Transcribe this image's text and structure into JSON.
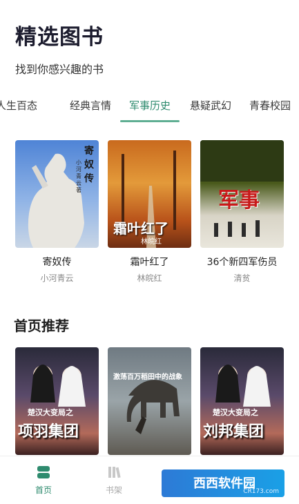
{
  "header": {
    "title": "精选图书",
    "subtitle": "找到你感兴趣的书"
  },
  "tabs": [
    {
      "label": "人生百态",
      "active": false
    },
    {
      "label": "经典言情",
      "active": false
    },
    {
      "label": "军事历史",
      "active": true
    },
    {
      "label": "悬疑武幻",
      "active": false
    },
    {
      "label": "青春校园",
      "active": false
    }
  ],
  "featured_books": [
    {
      "title": "寄奴传",
      "author": "小河青云",
      "cover_text": "寄奴传",
      "cover_sub": "小河青云 著"
    },
    {
      "title": "霜叶红了",
      "author": "林皖红",
      "cover_text": "霜叶红了",
      "cover_sub": "林皖红"
    },
    {
      "title": "36个新四军伤员",
      "author": "清贫",
      "cover_text": "军事"
    }
  ],
  "recommend": {
    "section_title": "首页推荐",
    "books": [
      {
        "cover_line1": "楚汉大变局之",
        "cover_line2": "项羽集团"
      },
      {
        "cover_line1": "激荡百万稻田中的战象"
      },
      {
        "cover_line1": "楚汉大变局之",
        "cover_line2": "刘邦集团"
      }
    ]
  },
  "bottom_nav": [
    {
      "label": "首页",
      "icon": "home-icon",
      "active": true
    },
    {
      "label": "书架",
      "icon": "bookshelf-icon",
      "active": false
    }
  ],
  "watermark": {
    "text": "西西软件园",
    "sub": "CR173.com"
  },
  "colors": {
    "accent": "#2e8b6e",
    "underline": "#5fae93"
  }
}
